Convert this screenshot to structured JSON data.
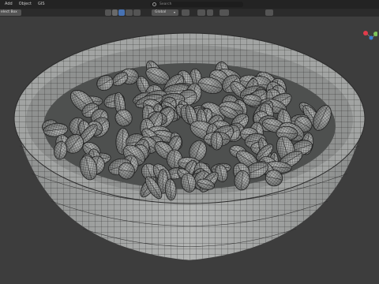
{
  "menu": [
    "Add",
    "Object",
    "GIS"
  ],
  "toolbar": {
    "transform_orientation": "Global",
    "search_placeholder": "Search",
    "select_mode_label": "elect Box"
  },
  "gizmo": {
    "x_color": "#e23b4b",
    "y_color": "#7dc35c",
    "z_color": "#3d7fd6"
  },
  "colors": {
    "background": "#3d3d3d",
    "header": "#232323",
    "accent": "#4772b3",
    "mesh": "#a7a9a8",
    "wire": "#2a2a2a"
  }
}
